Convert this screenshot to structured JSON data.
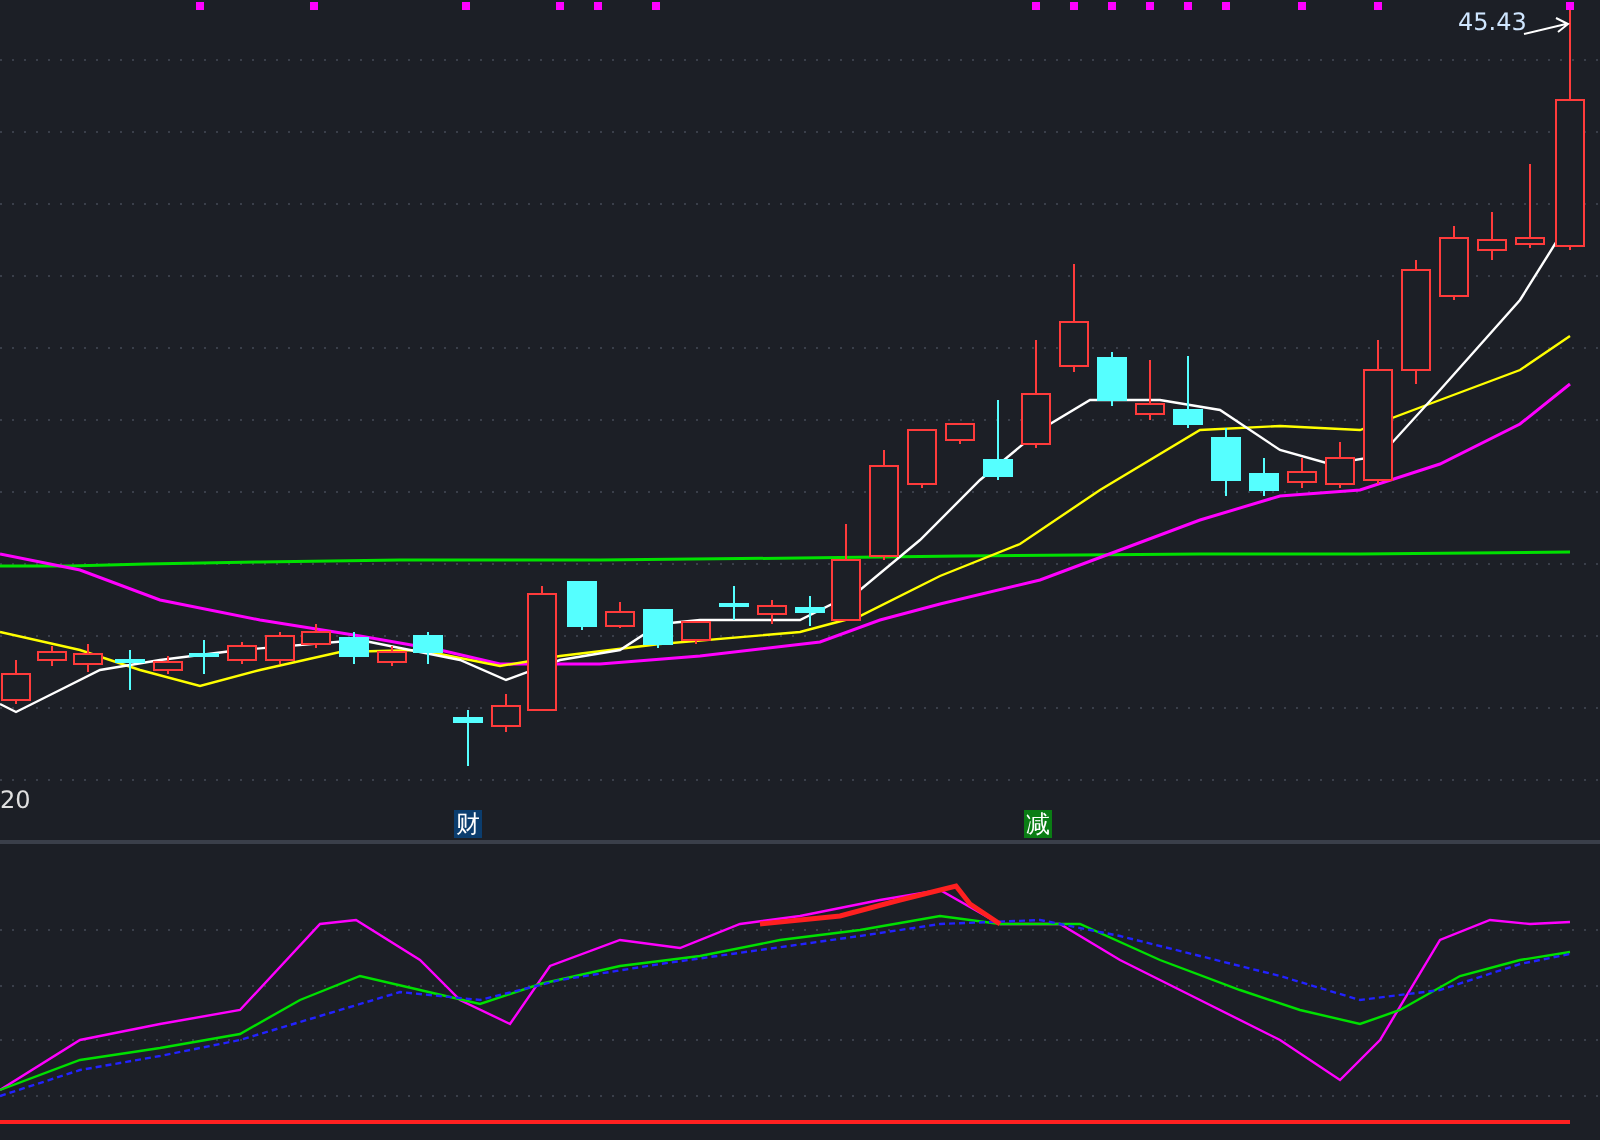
{
  "price_chart": {
    "high_label": "45.43",
    "axis_label": "20"
  },
  "markers": [
    {
      "label": "财",
      "color": "#0b3d6e"
    },
    {
      "label": "减",
      "color": "#0a7d14"
    }
  ]
}
